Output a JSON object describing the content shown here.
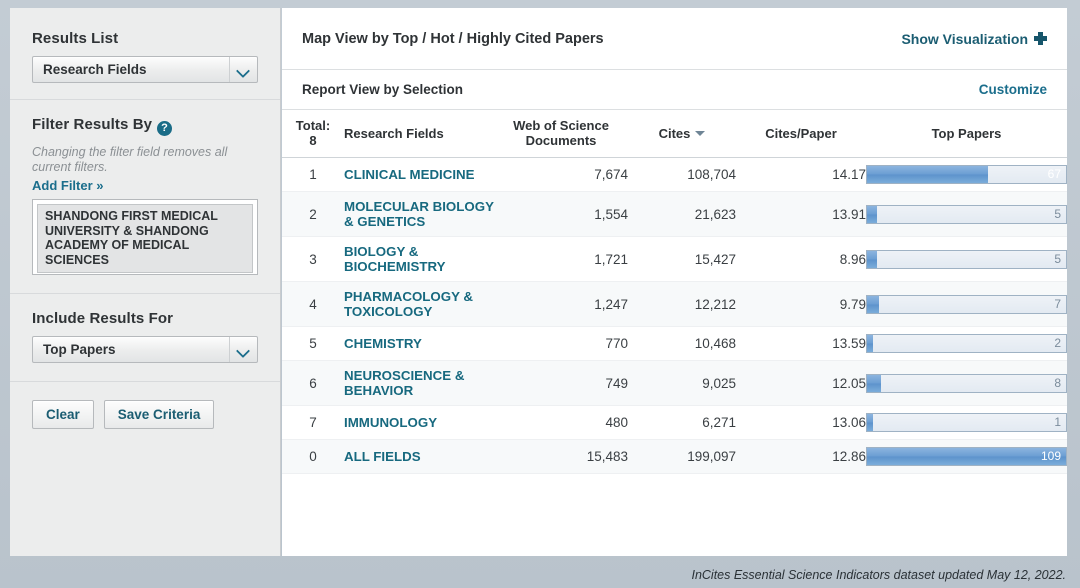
{
  "sidebar": {
    "results_list": {
      "heading": "Results List",
      "selected": "Research Fields",
      "chevron_icon": "chevron-down-icon"
    },
    "filter": {
      "heading": "Filter Results By",
      "help_icon": "?",
      "note": "Changing the filter field removes all current filters.",
      "add_filter": "Add Filter »",
      "items": [
        "SHANDONG FIRST MEDICAL UNIVERSITY & SHANDONG ACADEMY OF MEDICAL SCIENCES"
      ]
    },
    "include": {
      "heading": "Include Results For",
      "selected": "Top Papers",
      "chevron_icon": "chevron-down-icon"
    },
    "buttons": {
      "clear": "Clear",
      "save": "Save Criteria"
    }
  },
  "main": {
    "map_view_title": "Map View by Top / Hot / Highly Cited Papers",
    "show_visualization": "Show Visualization",
    "plus_icon": "plus-icon",
    "report_view_title": "Report View by Selection",
    "customize": "Customize"
  },
  "table": {
    "headers": {
      "rank": "Total:",
      "rank_count": "8",
      "field": "Research Fields",
      "wos_line1": "Web of Science",
      "wos_line2": "Documents",
      "cites": "Cites",
      "cites_sort_icon": "sort-descending-icon",
      "cites_per_paper": "Cites/Paper",
      "top_papers": "Top Papers"
    },
    "rows": [
      {
        "rank": "1",
        "field": "CLINICAL MEDICINE",
        "wos": "7,674",
        "cites": "108,704",
        "cpp": "14.17",
        "top": "67"
      },
      {
        "rank": "2",
        "field": "MOLECULAR BIOLOGY & GENETICS",
        "wos": "1,554",
        "cites": "21,623",
        "cpp": "13.91",
        "top": "5"
      },
      {
        "rank": "3",
        "field": "BIOLOGY & BIOCHEMISTRY",
        "wos": "1,721",
        "cites": "15,427",
        "cpp": "8.96",
        "top": "5"
      },
      {
        "rank": "4",
        "field": "PHARMACOLOGY & TOXICOLOGY",
        "wos": "1,247",
        "cites": "12,212",
        "cpp": "9.79",
        "top": "7"
      },
      {
        "rank": "5",
        "field": "CHEMISTRY",
        "wos": "770",
        "cites": "10,468",
        "cpp": "13.59",
        "top": "2"
      },
      {
        "rank": "6",
        "field": "NEUROSCIENCE & BEHAVIOR",
        "wos": "749",
        "cites": "9,025",
        "cpp": "12.05",
        "top": "8"
      },
      {
        "rank": "7",
        "field": "IMMUNOLOGY",
        "wos": "480",
        "cites": "6,271",
        "cpp": "13.06",
        "top": "1"
      },
      {
        "rank": "0",
        "field": "ALL FIELDS",
        "wos": "15,483",
        "cites": "199,097",
        "cpp": "12.86",
        "top": "109"
      }
    ]
  },
  "chart_data": {
    "type": "bar",
    "title": "Top Papers",
    "categories": [
      "CLINICAL MEDICINE",
      "MOLECULAR BIOLOGY & GENETICS",
      "BIOLOGY & BIOCHEMISTRY",
      "PHARMACOLOGY & TOXICOLOGY",
      "CHEMISTRY",
      "NEUROSCIENCE & BEHAVIOR",
      "IMMUNOLOGY",
      "ALL FIELDS"
    ],
    "values": [
      67,
      5,
      5,
      7,
      2,
      8,
      1,
      109
    ],
    "max": 109,
    "xlabel": "Research Fields",
    "ylabel": "Top Papers",
    "orientation": "horizontal",
    "grid": false,
    "legend": "none"
  },
  "footer": {
    "text": "InCites Essential Science Indicators dataset updated May 12, 2022."
  },
  "colors": {
    "link": "#17697f",
    "accent": "#1b6e8c",
    "bar_fill": "#6b9ed3",
    "page_bg": "#bdc7cf"
  }
}
